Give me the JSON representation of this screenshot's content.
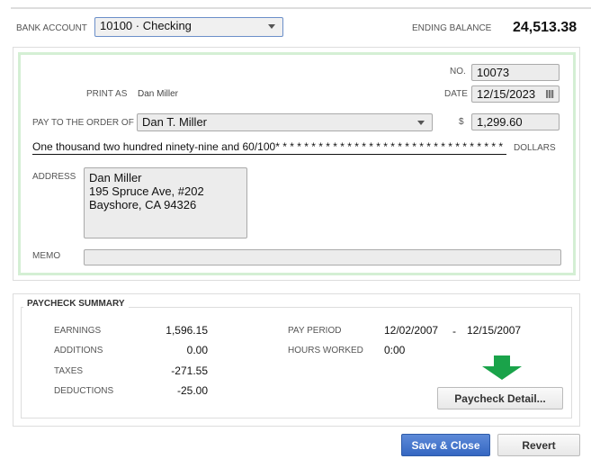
{
  "header": {
    "bank_account_label": "BANK ACCOUNT",
    "bank_account_value": "10100 · Checking",
    "ending_balance_label": "ENDING BALANCE",
    "ending_balance_value": "24,513.38"
  },
  "check": {
    "no_label": "NO.",
    "no_value": "10073",
    "print_as_label": "PRINT AS",
    "print_as_value": "Dan Miller",
    "date_label": "DATE",
    "date_value": "12/15/2023",
    "pay_to_label": "PAY TO THE ORDER OF",
    "pay_to_value": "Dan T. Miller",
    "dollar_sign": "$",
    "amount_value": "1,299.60",
    "amount_words": "One thousand two hundred ninety-nine and 60/100* * * * * * * * * * * * * * * * * * * * * * * * * * * * * * * *",
    "dollars_label": "DOLLARS",
    "address_label": "ADDRESS",
    "address_lines": [
      "Dan Miller",
      "195 Spruce Ave, #202",
      "Bayshore, CA 94326"
    ],
    "memo_label": "MEMO",
    "memo_value": ""
  },
  "summary": {
    "title": "PAYCHECK SUMMARY",
    "rows": [
      {
        "label": "EARNINGS",
        "value": "1,596.15"
      },
      {
        "label": "ADDITIONS",
        "value": "0.00"
      },
      {
        "label": "TAXES",
        "value": "-271.55"
      },
      {
        "label": "DEDUCTIONS",
        "value": "-25.00"
      }
    ],
    "pay_period_label": "PAY PERIOD",
    "pay_period_start": "12/02/2007",
    "pay_period_sep": "-",
    "pay_period_end": "12/15/2007",
    "hours_label": "HOURS WORKED",
    "hours_value": "0:00",
    "detail_button": "Paycheck Detail...",
    "arrow_color": "#1aa34a"
  },
  "footer": {
    "save_close": "Save & Close",
    "revert": "Revert"
  }
}
